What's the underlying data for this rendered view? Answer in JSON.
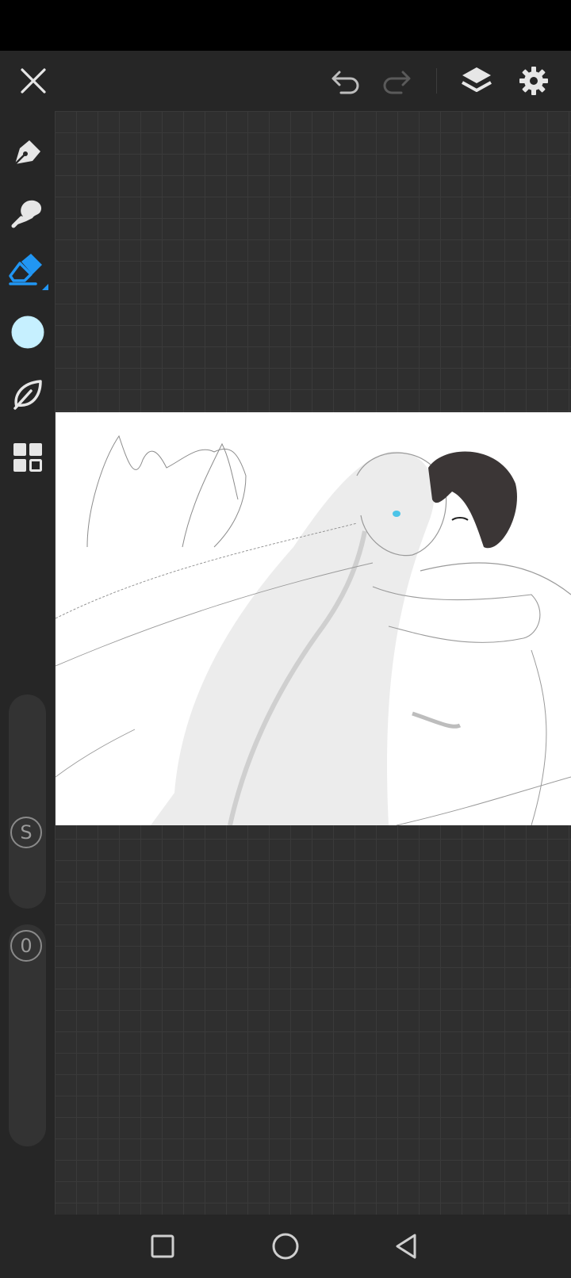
{
  "app": {
    "accent": "#2196f3",
    "brush_color": "#c6f0ff"
  },
  "topbar": {
    "close_icon": "close-icon",
    "undo_icon": "undo-icon",
    "redo_icon": "redo-icon",
    "layers_icon": "layers-icon",
    "settings_icon": "gear-icon"
  },
  "tools": [
    {
      "name": "pen",
      "icon": "pen-icon",
      "selected": false
    },
    {
      "name": "smudge",
      "icon": "smudge-icon",
      "selected": false
    },
    {
      "name": "eraser",
      "icon": "eraser-icon",
      "selected": true
    },
    {
      "name": "color",
      "icon": "color-swatch",
      "selected": false
    },
    {
      "name": "brush-library",
      "icon": "leaf-icon",
      "selected": false
    },
    {
      "name": "menu",
      "icon": "grid-icon",
      "selected": false
    }
  ],
  "sliders": {
    "size_label": "S",
    "opacity_label": "0"
  },
  "navbar": {
    "recents_icon": "square-icon",
    "home_icon": "circle-icon",
    "back_icon": "triangle-back-icon"
  }
}
